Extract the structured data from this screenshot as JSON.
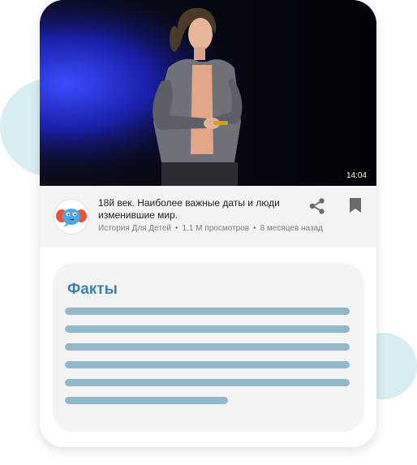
{
  "video": {
    "duration": "14:04"
  },
  "channel": {
    "avatar_icon": "elephant-icon"
  },
  "info": {
    "title": "18й век. Наиболее важные даты и люди изменившие мир.",
    "channel_name": "История Для Детей",
    "views": "1.1 М просмотров",
    "age": "8 месяцев назад",
    "separator": "•",
    "share_icon": "share-icon",
    "bookmark_icon": "bookmark-icon"
  },
  "facts": {
    "title": "Факты",
    "placeholder_line_count": 6
  },
  "colors": {
    "accent": "#3c82a8",
    "placeholder_line": "#92b8cc",
    "blob": "#d9eef2",
    "panel_bg": "#f4f4f4"
  }
}
